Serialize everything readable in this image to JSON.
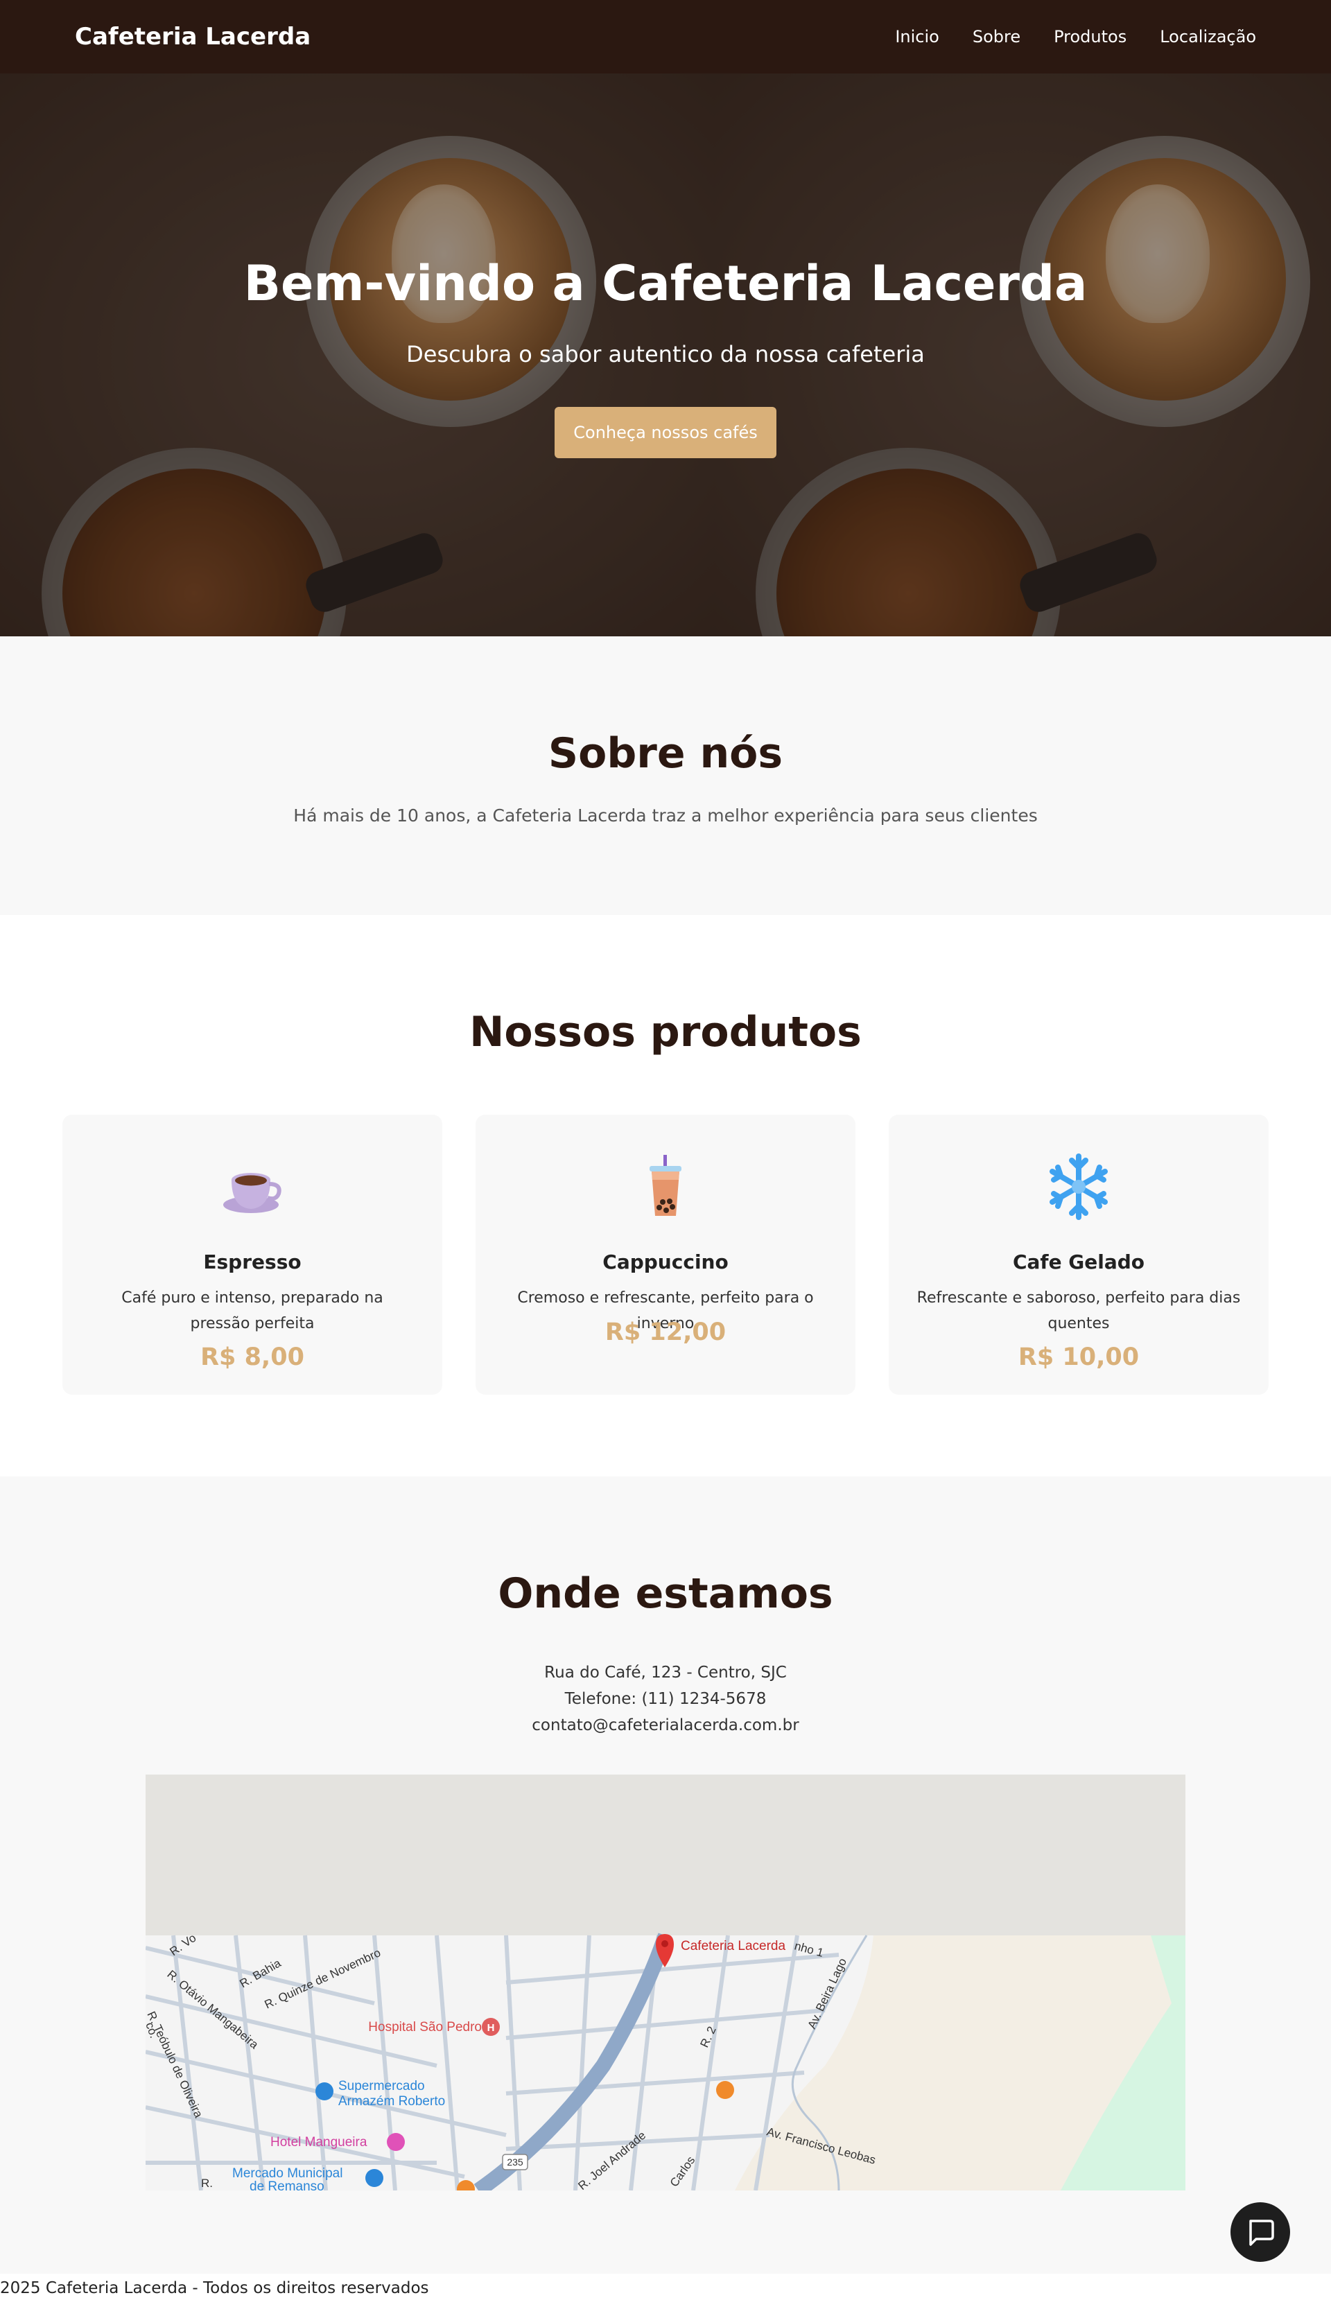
{
  "nav": {
    "brand": "Cafeteria Lacerda",
    "links": [
      "Inicio",
      "Sobre",
      "Produtos",
      "Localização"
    ]
  },
  "hero": {
    "title": "Bem-vindo a Cafeteria Lacerda",
    "subtitle": "Descubra o sabor autentico da nossa cafeteria",
    "button": "Conheça nossos cafés"
  },
  "about": {
    "title": "Sobre nós",
    "text": "Há mais de 10 anos, a Cafeteria Lacerda traz a melhor experiência para seus clientes"
  },
  "products": {
    "title": "Nossos produtos",
    "items": [
      {
        "icon": "hot-coffee-cup-icon",
        "name": "Espresso",
        "desc": "Café puro e intenso, preparado na pressão perfeita",
        "price": "R$ 8,00"
      },
      {
        "icon": "bubble-tea-icon",
        "name": "Cappuccino",
        "desc": "Cremoso e refrescante, perfeito para o inverno",
        "price": "R$ 12,00"
      },
      {
        "icon": "snowflake-icon",
        "name": "Cafe Gelado",
        "desc": "Refrescante e saboroso, perfeito para dias quentes",
        "price": "R$ 10,00"
      }
    ]
  },
  "location": {
    "title": "Onde estamos",
    "address": "Rua do Café, 123 - Centro, SJC",
    "phone": "Telefone: (11) 1234-5678",
    "email": "contato@cafeterialacerda.com.br"
  },
  "map": {
    "marker_label": "Cafeteria Lacerda",
    "places": {
      "hospital": "Hospital São Pedro",
      "supermarket_1": "Supermercado",
      "supermarket_2": "Armazém Roberto",
      "hotel": "Hotel Mangueira",
      "market_1": "Mercado Municipal",
      "market_2": "de Remanso"
    },
    "streets": {
      "s1": "R. Vo",
      "s2": "R. Bahia",
      "s3": "R. Quinze de Novembro",
      "s4": "R. Otávio Mangabeira",
      "s5": "R. Teóbulo de Oliveira",
      "s6": "R. 2",
      "s7": "Av. Beira Lago",
      "s8": "nho 1",
      "s9": "Av. Francisco Leobas",
      "s10": "R. Joel Andrade",
      "s11": "Carlos",
      "s12": "co.",
      "s13": "R."
    },
    "road_number": "235",
    "colors": {
      "road": "#8fa8c8",
      "street": "#c9d2dd",
      "block": "#f4f4f4",
      "sand": "#f3eee4",
      "green": "#d6f5e2",
      "marker": "#e53935"
    }
  },
  "footer": {
    "text": "2025 Cafeteria Lacerda - Todos os direitos reservados"
  },
  "colors": {
    "nav_bg": "#2b1811",
    "accent": "#d9b079",
    "heading": "#2b1811",
    "section_bg": "#f8f8f8"
  }
}
